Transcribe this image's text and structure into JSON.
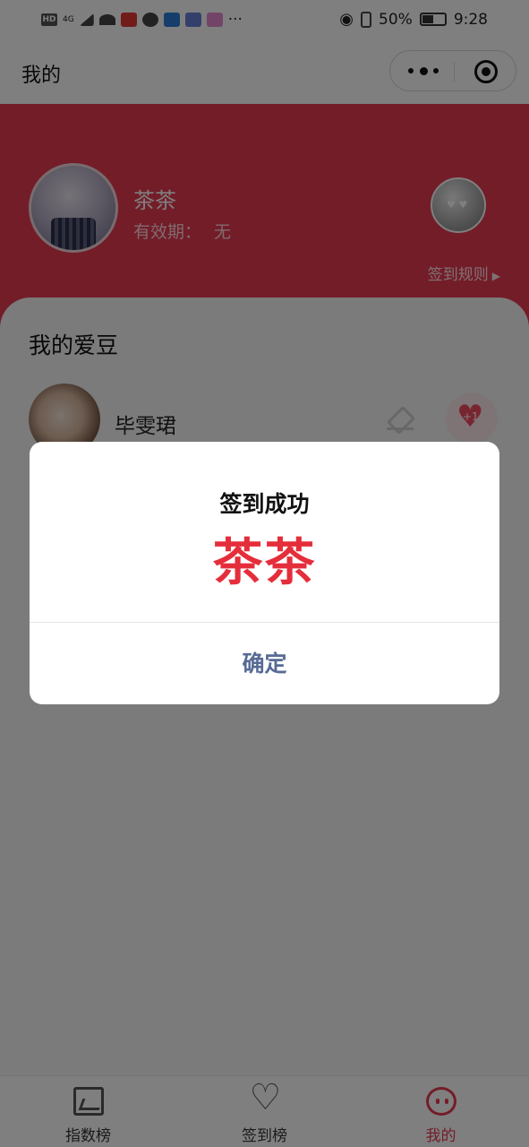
{
  "status_bar": {
    "network": "HD",
    "signal": "4G",
    "battery": "50%",
    "time": "9:28",
    "more": "···"
  },
  "nav": {
    "title": "我的"
  },
  "profile": {
    "name": "茶茶",
    "validity_label": "有效期：",
    "validity_value": "无",
    "rules_link": "签到规则"
  },
  "idols": {
    "section_title": "我的爱豆",
    "items": [
      {
        "name": "毕雯珺",
        "plus_label": "+1"
      }
    ]
  },
  "tabs": [
    {
      "label": "指数榜",
      "icon": "chart-icon",
      "active": false
    },
    {
      "label": "签到榜",
      "icon": "heartbeat-icon",
      "active": false
    },
    {
      "label": "我的",
      "icon": "pig-face-icon",
      "active": true
    }
  ],
  "dialog": {
    "title": "签到成功",
    "content": "茶茶",
    "confirm_label": "确定"
  },
  "colors": {
    "brand_red": "#e63a52",
    "dialog_highlight": "#e52e3b",
    "confirm_blue": "#576b95"
  }
}
